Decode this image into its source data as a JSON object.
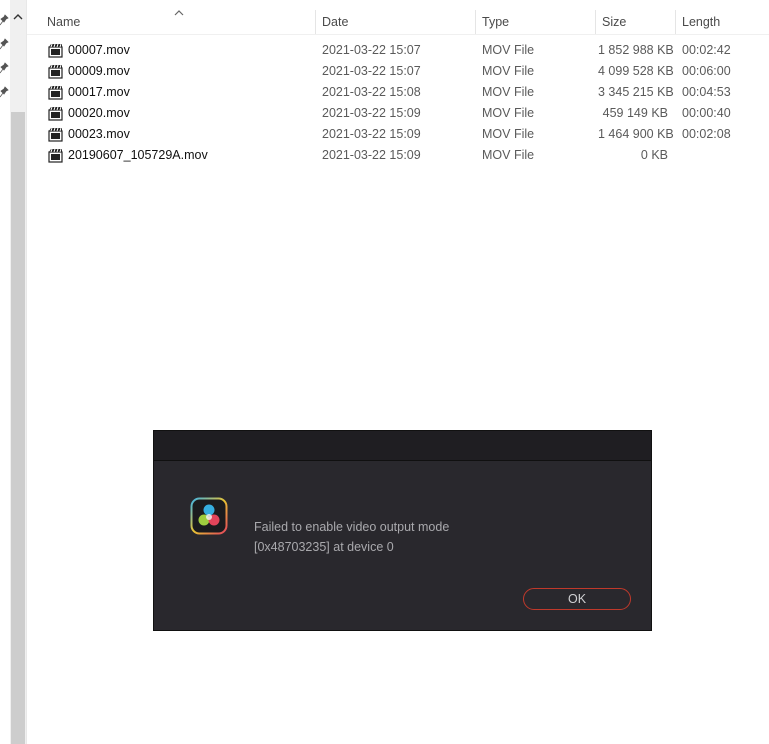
{
  "columns": {
    "name": "Name",
    "date": "Date",
    "type": "Type",
    "size": "Size",
    "length": "Length"
  },
  "files": [
    {
      "name": "00007.mov",
      "date": "2021-03-22 15:07",
      "type": "MOV File",
      "size": "1 852 988 KB",
      "length": "00:02:42"
    },
    {
      "name": "00009.mov",
      "date": "2021-03-22 15:07",
      "type": "MOV File",
      "size": "4 099 528 KB",
      "length": "00:06:00"
    },
    {
      "name": "00017.mov",
      "date": "2021-03-22 15:08",
      "type": "MOV File",
      "size": "3 345 215 KB",
      "length": "00:04:53"
    },
    {
      "name": "00020.mov",
      "date": "2021-03-22 15:09",
      "type": "MOV File",
      "size": "459 149 KB",
      "length": "00:00:40"
    },
    {
      "name": "00023.mov",
      "date": "2021-03-22 15:09",
      "type": "MOV File",
      "size": "1 464 900 KB",
      "length": "00:02:08"
    },
    {
      "name": "20190607_105729A.mov",
      "date": "2021-03-22 15:09",
      "type": "MOV File",
      "size": "0 KB",
      "length": ""
    }
  ],
  "dialog": {
    "message_line1": "Failed to enable video output mode",
    "message_line2": "[0x48703235] at device 0",
    "ok_label": "OK",
    "icon": "davinci-resolve-icon"
  },
  "colors": {
    "dialog_bg": "#29282d",
    "dialog_title_bg": "#1f1e22",
    "ok_border": "#c0392b"
  }
}
